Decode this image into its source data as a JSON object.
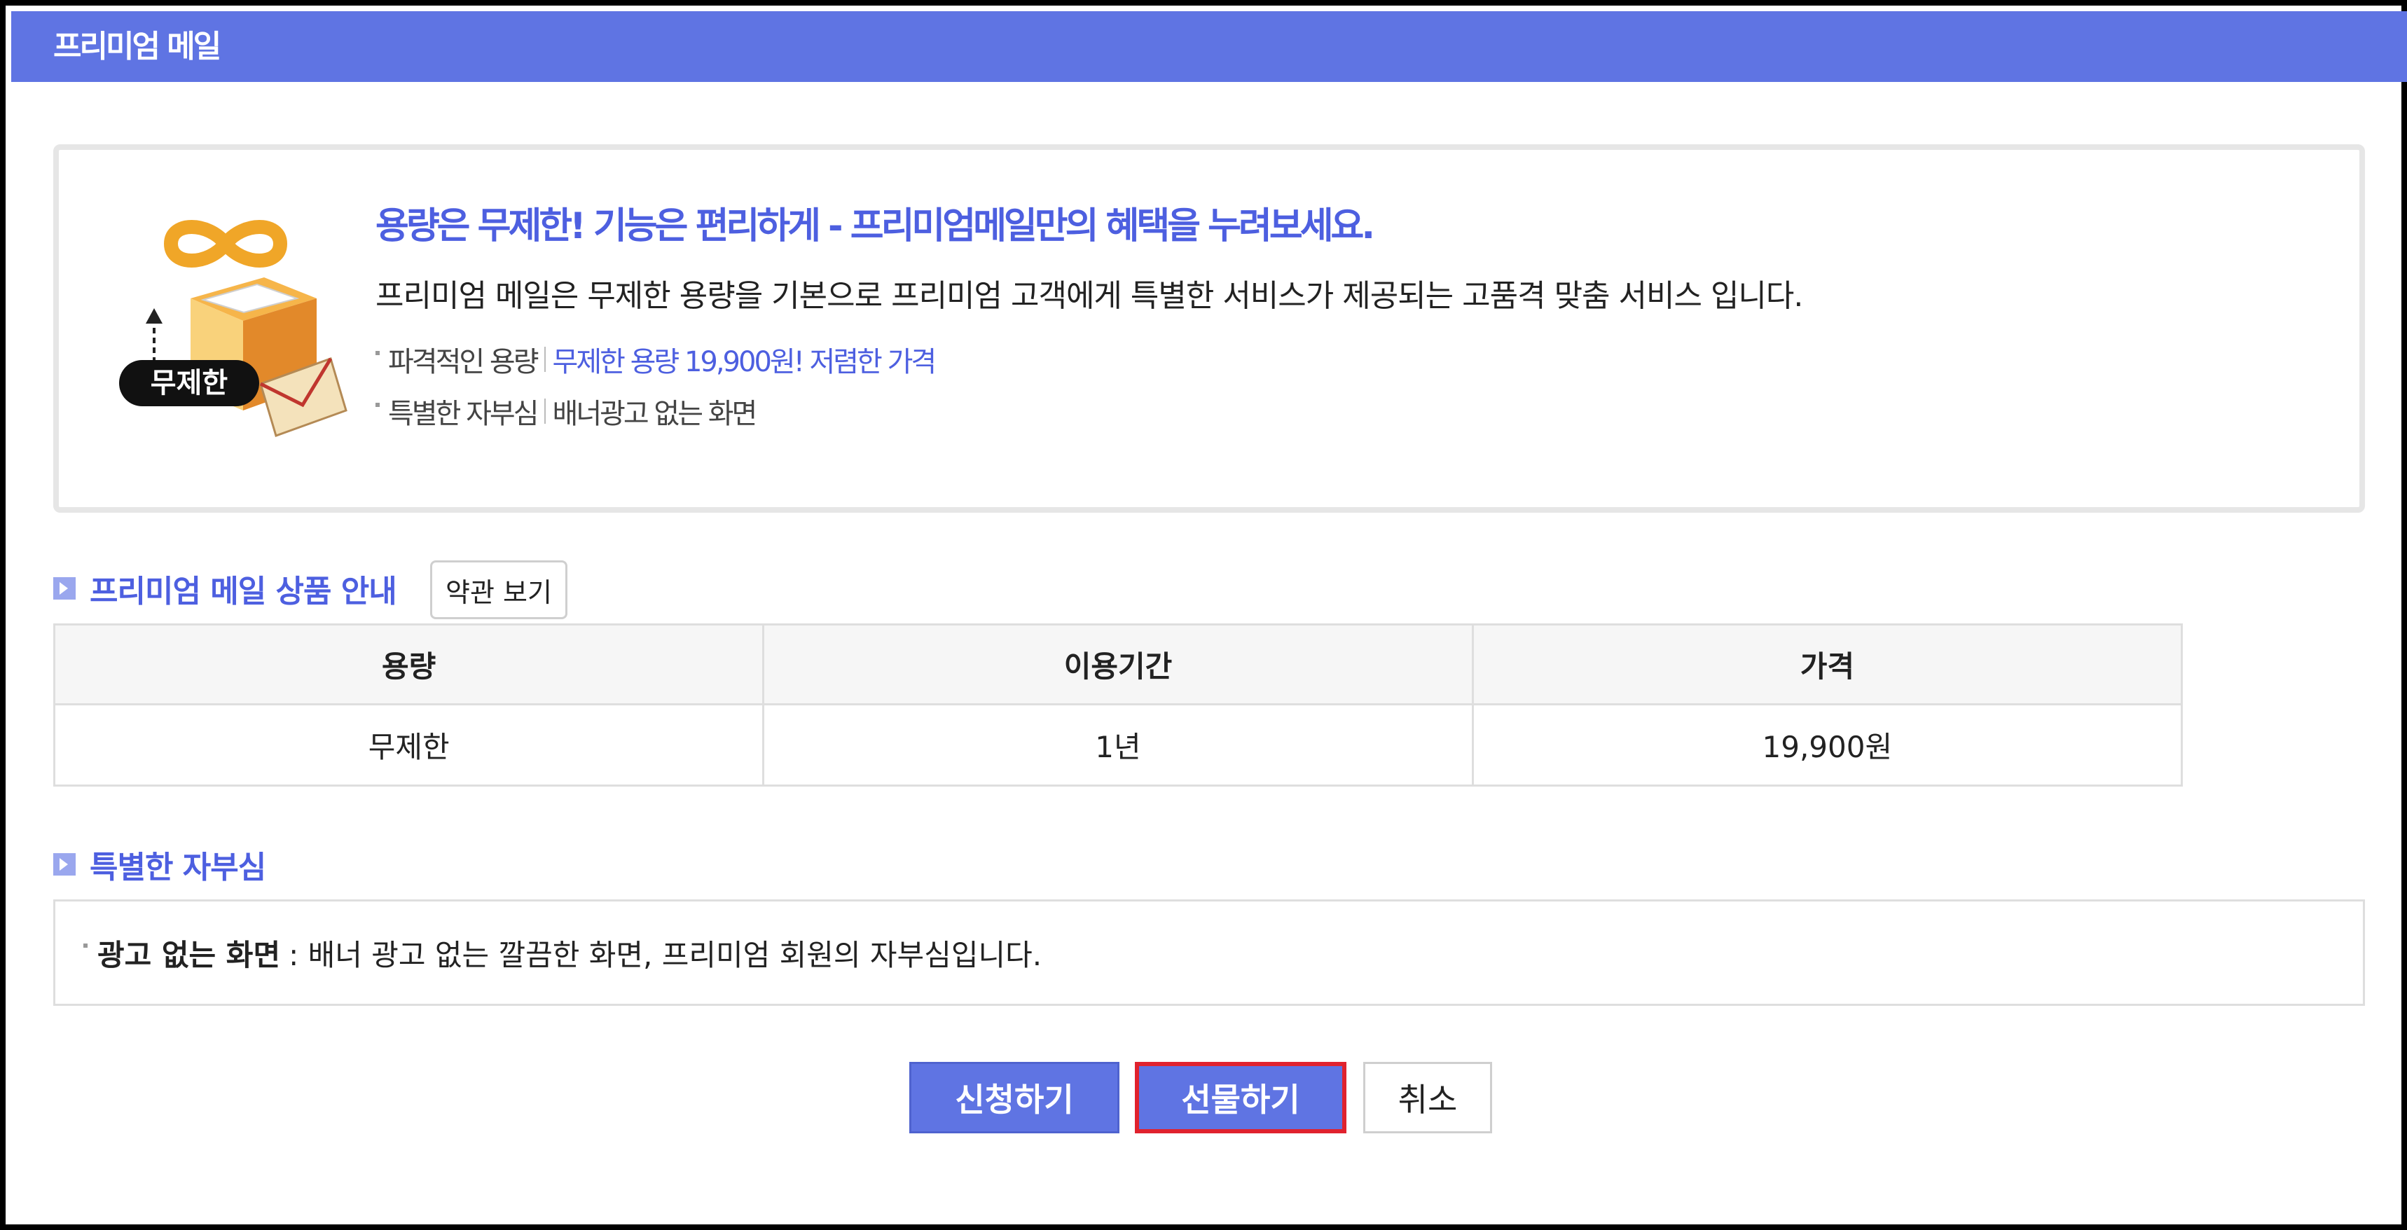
{
  "header": {
    "title": "프리미엄 메일"
  },
  "intro": {
    "icon_label": "무제한",
    "headline": "용량은 무제한! 기능은 편리하게 - 프리미엄메일만의 혜택을 누려보세요.",
    "description": "프리미엄 메일은 무제한 용량을 기본으로 프리미엄 고객에게 특별한 서비스가 제공되는 고품격 맞춤 서비스 입니다.",
    "bullets": [
      {
        "label": "파격적인 용량",
        "value": "무제한 용량 19,900원! 저렴한 가격"
      },
      {
        "label": "특별한 자부심",
        "value": "배너광고 없는 화면"
      }
    ]
  },
  "product_section": {
    "title": "프리미엄 메일 상품 안내",
    "terms_button": "약관 보기",
    "table": {
      "headers": [
        "용량",
        "이용기간",
        "가격"
      ],
      "rows": [
        [
          "무제한",
          "1년",
          "19,900원"
        ]
      ]
    }
  },
  "pride_section": {
    "title": "특별한 자부심",
    "item_strong": "광고 없는 화면",
    "item_text": ": 배너 광고 없는 깔끔한 화면, 프리미엄 회원의 자부심입니다."
  },
  "buttons": {
    "apply": "신청하기",
    "gift": "선물하기",
    "cancel": "취소"
  },
  "colors": {
    "brand": "#5f74e3",
    "accent_text": "#4d5fe0",
    "highlight_border": "#e0222e"
  }
}
